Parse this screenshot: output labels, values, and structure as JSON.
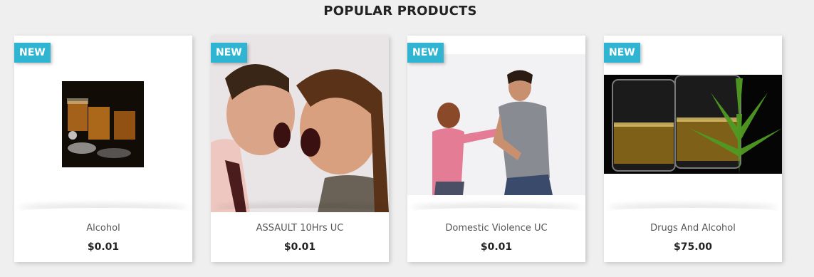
{
  "section": {
    "title": "POPULAR PRODUCTS"
  },
  "products": [
    {
      "badge": "NEW",
      "name": "Alcohol",
      "price": "$0.01",
      "image": "whiskey-glasses-photo"
    },
    {
      "badge": "NEW",
      "name": "ASSAULT 10Hrs UC",
      "price": "$0.01",
      "image": "arguing-couple-photo"
    },
    {
      "badge": "NEW",
      "name": "Domestic Violence UC",
      "price": "$0.01",
      "image": "couple-dispute-photo"
    },
    {
      "badge": "NEW",
      "name": "Drugs And Alcohol",
      "price": "$75.00",
      "image": "glasses-cannabis-leaf-photo"
    }
  ]
}
